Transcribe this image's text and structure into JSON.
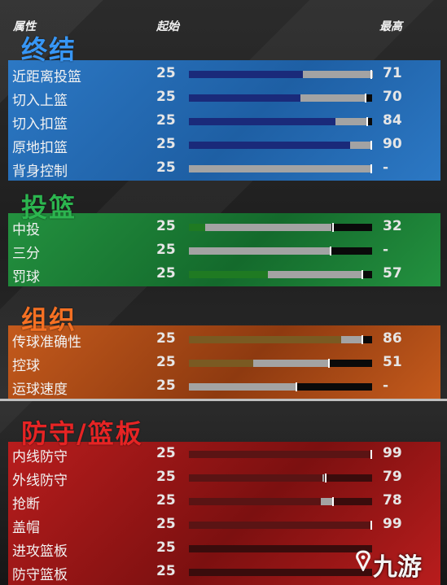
{
  "header": {
    "col_attr": "属性",
    "col_start": "起始",
    "col_max": "最高"
  },
  "colors": {
    "blue": "#1e5fa4",
    "green": "#1c7a3a",
    "orange": "#a94914",
    "red": "#9c1616",
    "blue_fill": "#1a2a7a",
    "green_fill": "#1f7a22",
    "orange_fill": "#7a5a22",
    "red_fill": "#5a1414",
    "grey_fill": "#a3a3a3"
  },
  "sections": [
    {
      "title": "终结",
      "theme": "blue",
      "rows": [
        {
          "label": "近距离投篮",
          "start": "25",
          "max": "71",
          "base": 0.62,
          "gray_end": 1.0,
          "end": 1.0
        },
        {
          "label": "切入上篮",
          "start": "25",
          "max": "70",
          "base": 0.61,
          "gray_end": 0.96,
          "end": 0.96
        },
        {
          "label": "切入扣篮",
          "start": "25",
          "max": "84",
          "base": 0.8,
          "gray_end": 0.97,
          "end": 0.97
        },
        {
          "label": "原地扣篮",
          "start": "25",
          "max": "90",
          "base": 0.88,
          "gray_end": 1.0,
          "end": 1.0
        },
        {
          "label": "背身控制",
          "start": "25",
          "max": "-",
          "base": 0.0,
          "gray_end": 1.0,
          "end": 1.0
        }
      ]
    },
    {
      "title": "投篮",
      "theme": "green",
      "rows": [
        {
          "label": "中投",
          "start": "25",
          "max": "32",
          "base": 0.09,
          "gray_end": 0.78,
          "end": 0.78
        },
        {
          "label": "三分",
          "start": "25",
          "max": "-",
          "base": 0.0,
          "gray_end": 0.77,
          "end": 0.77
        },
        {
          "label": "罚球",
          "start": "25",
          "max": "57",
          "base": 0.43,
          "gray_end": 0.94,
          "end": 0.94
        }
      ]
    },
    {
      "title": "组织",
      "theme": "orange",
      "rows": [
        {
          "label": "传球准确性",
          "start": "25",
          "max": "86",
          "base": 0.83,
          "gray_end": 0.94,
          "end": 0.94
        },
        {
          "label": "控球",
          "start": "25",
          "max": "51",
          "base": 0.35,
          "gray_end": 0.76,
          "end": 0.76
        },
        {
          "label": "运球速度",
          "start": "25",
          "max": "-",
          "base": 0.0,
          "gray_end": 0.58,
          "end": 0.58
        }
      ]
    },
    {
      "title": "防守/篮板",
      "theme": "red",
      "rows": [
        {
          "label": "内线防守",
          "start": "25",
          "max": "99",
          "base": 0.99,
          "gray_end": 0.99,
          "end": 0.99
        },
        {
          "label": "外线防守",
          "start": "25",
          "max": "79",
          "base": 0.73,
          "gray_end": 0.74,
          "end": 0.74
        },
        {
          "label": "抢断",
          "start": "25",
          "max": "78",
          "base": 0.72,
          "gray_end": 0.78,
          "end": 0.78
        },
        {
          "label": "盖帽",
          "start": "25",
          "max": "99",
          "base": 0.99,
          "gray_end": 0.99,
          "end": 0.99
        },
        {
          "label": "进攻篮板",
          "start": "25",
          "max": "",
          "base": 0.0,
          "gray_end": 0.0,
          "end": 0.0
        },
        {
          "label": "防守篮板",
          "start": "25",
          "max": "",
          "base": 0.0,
          "gray_end": 0.0,
          "end": 0.0
        }
      ]
    }
  ],
  "watermark": "九游"
}
